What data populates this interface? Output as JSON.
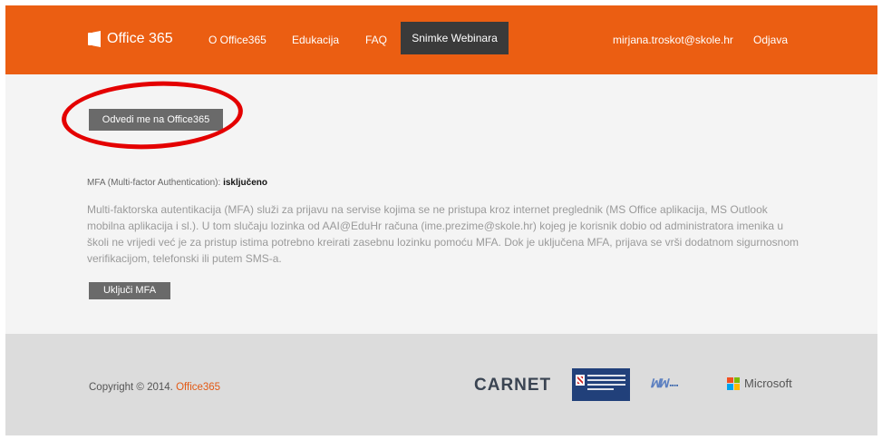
{
  "nav": {
    "brand": "Office 365",
    "links": [
      "O Office365",
      "Edukacija",
      "FAQ"
    ],
    "active": "Snimke Webinara",
    "user_email": "mirjana.troskot@skole.hr",
    "logout": "Odjava"
  },
  "main": {
    "go_button": "Odvedi me na Office365",
    "mfa_label": "MFA (Multi-factor Authentication): ",
    "mfa_status": "isključeno",
    "description": "Multi-faktorska autentikacija (MFA) služi za prijavu na servise kojima se ne pristupa kroz internet preglednik (MS Office aplikacija, MS Outlook mobilna aplikacija i sl.). U tom slučaju lozinka od AAI@EduHr računa (ime.prezime@skole.hr) kojeg je korisnik dobio od administratora imenika u školi ne vrijedi već je za pristup istima potrebno kreirati zasebnu lozinku pomoću MFA. Dok je uključena MFA, prijava se vrši dodatnom sigurnosnom verifikacijom, telefonski ili putem SMS-a.",
    "enable_button": "Uključi MFA"
  },
  "footer": {
    "copyright": "Copyright © 2014. ",
    "copyright_link": "Office365",
    "partners": {
      "carnet": "CARNET",
      "microsoft": "Microsoft"
    }
  },
  "colors": {
    "brand_orange": "#eb5e12",
    "highlight_red": "#e40000",
    "button_gray": "#6a6a6a"
  }
}
